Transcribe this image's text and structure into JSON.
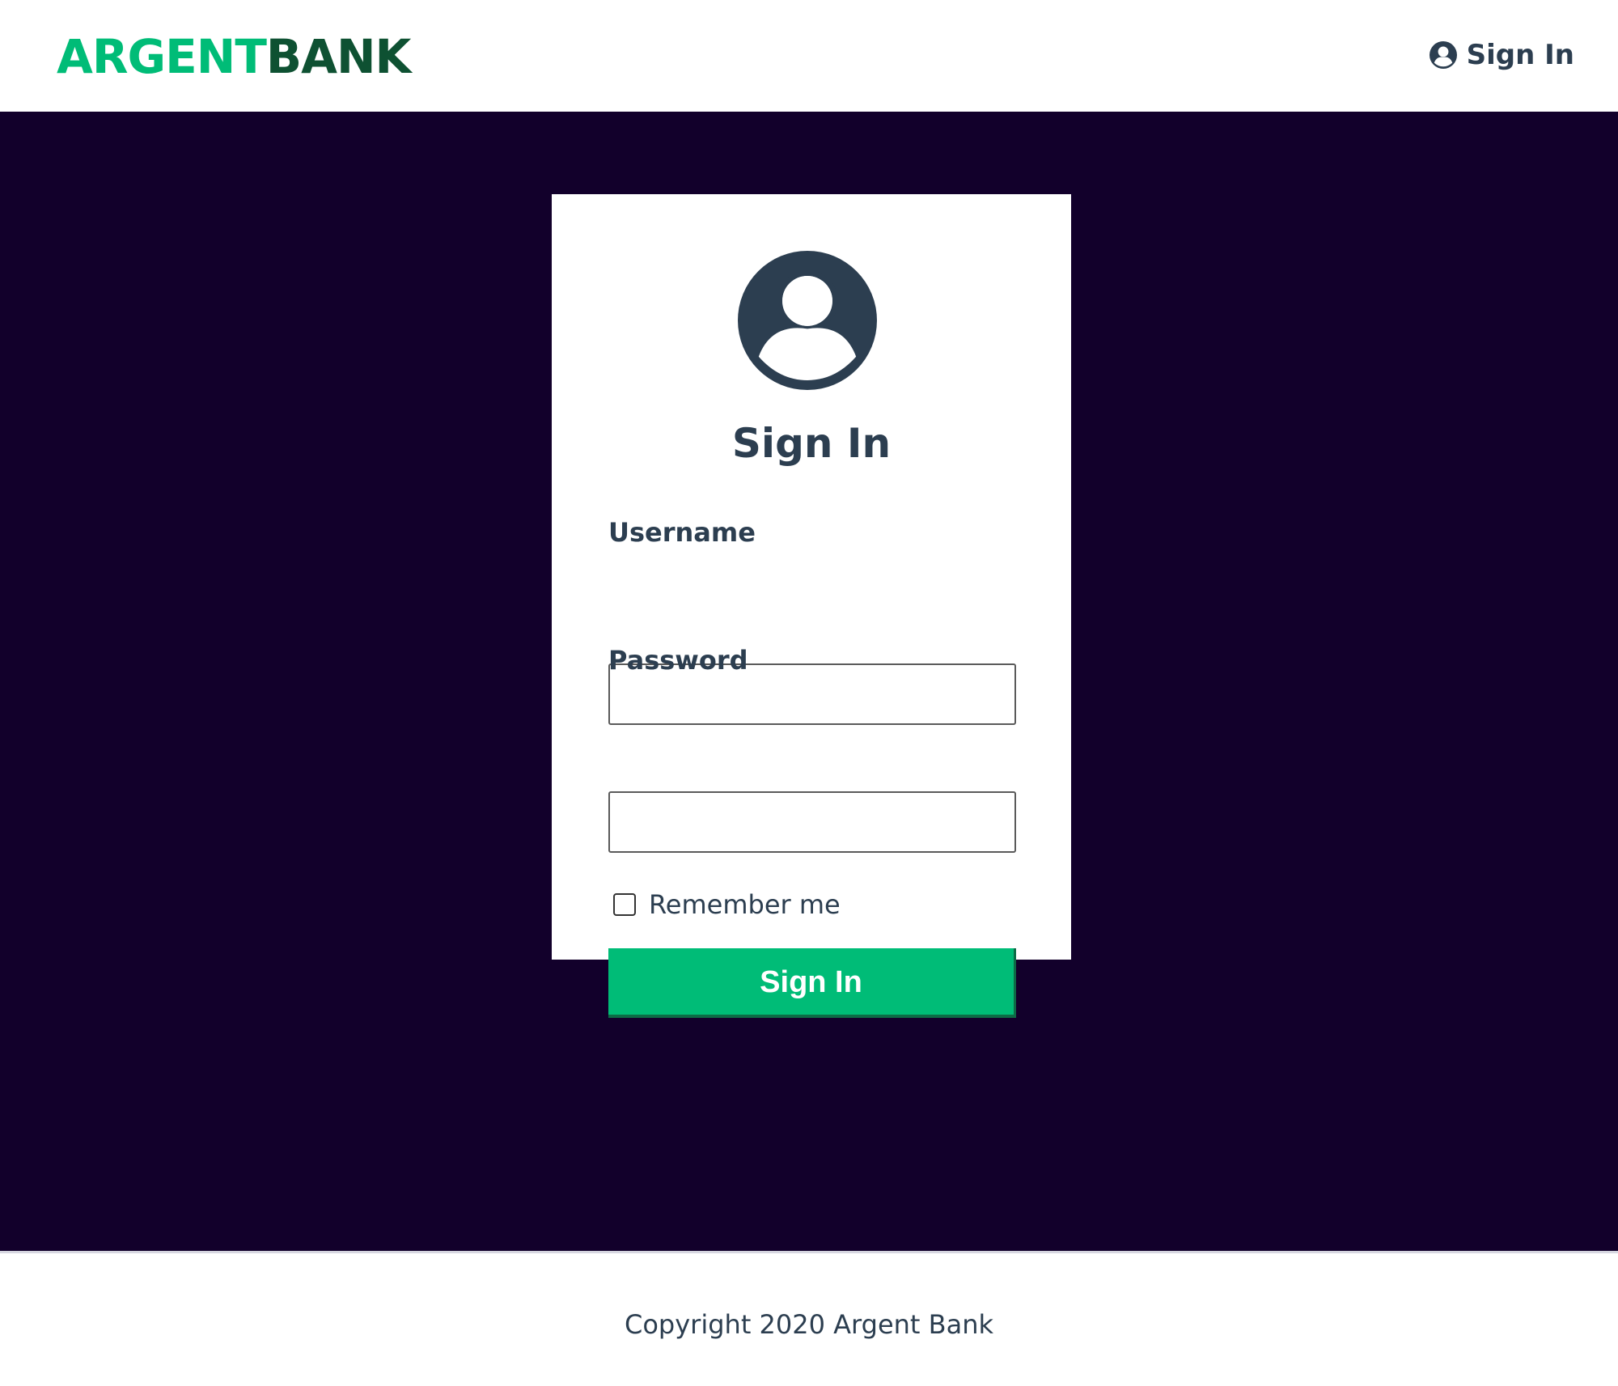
{
  "header": {
    "logo": {
      "part_1": "ARGENT",
      "part_2": "BANK"
    },
    "nav_sign_in_label": "Sign In",
    "nav_icon": "user-circle-icon"
  },
  "sign_in_card": {
    "avatar_icon": "user-circle-icon",
    "title": "Sign In",
    "username": {
      "label": "Username",
      "value": "",
      "placeholder": ""
    },
    "password": {
      "label": "Password",
      "value": "",
      "placeholder": ""
    },
    "remember_me": {
      "label": "Remember me",
      "checked": false
    },
    "submit_label": "Sign In"
  },
  "footer": {
    "copyright": "Copyright 2020 Argent Bank"
  },
  "colors": {
    "brand_green": "#00bc77",
    "brand_dark_green": "#0e5132",
    "background_dark": "#12002b",
    "text_primary": "#2c3e50"
  }
}
